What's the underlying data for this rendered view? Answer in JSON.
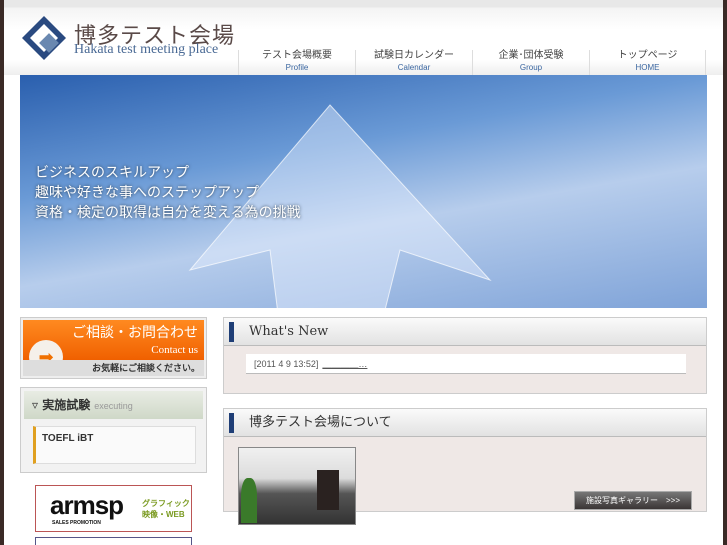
{
  "header": {
    "logo_jp": "博多テスト会場",
    "logo_en": "Hakata test meeting place"
  },
  "nav": [
    {
      "jp": "テスト会場概要",
      "en": "Profile"
    },
    {
      "jp": "試験日カレンダー",
      "en": "Calendar"
    },
    {
      "jp": "企業･団体受験",
      "en": "Group"
    },
    {
      "jp": "トップページ",
      "en": "HOME"
    }
  ],
  "hero": {
    "lines": [
      "ビジネスのスキルアップ",
      "趣味や好きな事へのステップアップ",
      "資格・検定の取得は自分を変える為の挑戦"
    ]
  },
  "contact": {
    "jp": "ご相談・お問合わせ",
    "en": "Contact us",
    "sub": "お気軽にご相談ください。"
  },
  "executing": {
    "title": "実施試験",
    "subtitle": "executing",
    "items": [
      "TOEFL iBT"
    ]
  },
  "banners": {
    "armsp": {
      "logo": "armsp",
      "sub": "SALES PROMOTION",
      "side1": "グラフィック",
      "side2": "映像・WEB"
    }
  },
  "whats_new": {
    "title": "What's New",
    "items": [
      {
        "date": "[2011 4 9 13:52]",
        "link": "＿＿＿＿…"
      }
    ]
  },
  "about": {
    "title": "博多テスト会場について",
    "gallery_button": "施設写真ギャラリー　>>>"
  },
  "colors": {
    "accent": "#1f3e76",
    "contact_orange": "#f06000",
    "border": "#3a2a26"
  }
}
